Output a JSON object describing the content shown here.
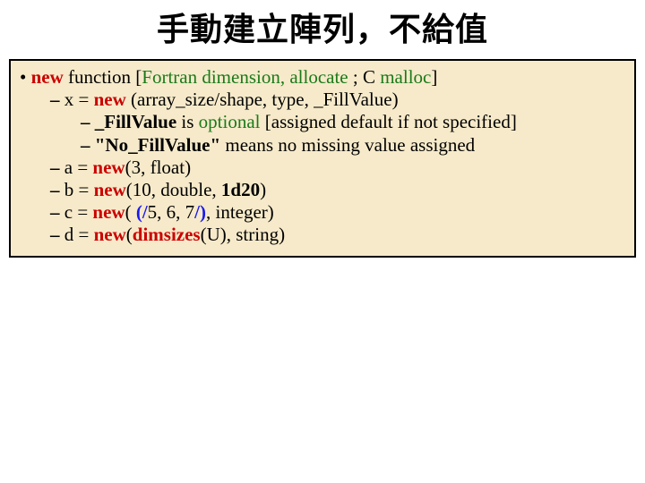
{
  "title": "手動建立陣列，不給值",
  "lines": {
    "l0": {
      "pre": " function  [",
      "new": "new",
      "fortran": "Fortran dimension, allocate",
      "sep": " ; C ",
      "malloc": "malloc",
      "post": "]"
    },
    "l1": {
      "pre": "x = ",
      "new": "new",
      "args": " (array_size/shape, type, _FillValue)"
    },
    "l2": {
      "fill": "_FillValue",
      "is": " is ",
      "opt": "optional",
      "rest": " [assigned default if not specified]"
    },
    "l3": {
      "q": "\"No_FillValue\"",
      "rest": " means no missing value assigned"
    },
    "l4": {
      "pre": "a = ",
      "new": "new",
      "args": "(3, float)"
    },
    "l5": {
      "pre": "b = ",
      "new": "new",
      "args1": "(10, double, ",
      "d20": "1d20",
      "args2": ")"
    },
    "l6": {
      "pre": "c = ",
      "new": "new",
      "o": "( ",
      "s1": "(/",
      "mid": "5, 6, 7",
      "s2": "/)",
      "rest": ", integer)"
    },
    "l7": {
      "pre": "d = ",
      "new": "new",
      "o": "(",
      "dims": "dimsizes",
      "rest": "(U), string)"
    }
  }
}
